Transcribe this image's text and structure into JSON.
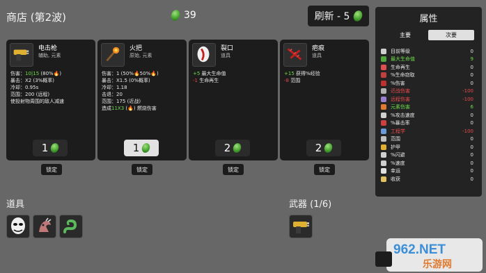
{
  "header": {
    "shop_title": "商店 (第2波)",
    "currency": "39",
    "refresh_label": "刷新 - 5"
  },
  "cards": [
    {
      "name": "电击枪",
      "tags": "辅助, 元素",
      "icon": "taser-icon",
      "stats": [
        {
          "parts": [
            {
              "t": "伤害：",
              "c": ""
            },
            {
              "t": "10|15",
              "c": "pos"
            },
            {
              "t": " (80%🔥)",
              "c": ""
            }
          ]
        },
        {
          "parts": [
            {
              "t": "暴击：X2 (3%概率)",
              "c": ""
            }
          ]
        },
        {
          "parts": [
            {
              "t": "冷却：0.95s",
              "c": ""
            }
          ]
        },
        {
          "parts": [
            {
              "t": "范围：200 (远程)",
              "c": ""
            }
          ]
        },
        {
          "parts": [
            {
              "t": "使投射物周围的敌人减速",
              "c": ""
            }
          ]
        }
      ],
      "price": "1",
      "price_style": "dark",
      "lock_label": "锁定"
    },
    {
      "name": "火把",
      "tags": "原始, 元素",
      "icon": "torch-icon",
      "stats": [
        {
          "parts": [
            {
              "t": "伤害：1 (50%🔥50%🔥)",
              "c": ""
            }
          ]
        },
        {
          "parts": [
            {
              "t": "暴击：X1.5 (0%概率)",
              "c": ""
            }
          ]
        },
        {
          "parts": [
            {
              "t": "冷却：1.18",
              "c": ""
            }
          ]
        },
        {
          "parts": [
            {
              "t": "击退：20",
              "c": ""
            }
          ]
        },
        {
          "parts": [
            {
              "t": "范围：175 (近战)",
              "c": ""
            }
          ]
        },
        {
          "parts": [
            {
              "t": "造成",
              "c": ""
            },
            {
              "t": "11X3",
              "c": "pos"
            },
            {
              "t": " (🔥) 燃烧伤害",
              "c": ""
            }
          ]
        }
      ],
      "price": "1",
      "price_style": "light",
      "lock_label": "锁定"
    },
    {
      "name": "裂口",
      "tags": "道具",
      "icon": "rift-icon",
      "stats": [
        {
          "parts": [
            {
              "t": "+5",
              "c": "pos"
            },
            {
              "t": " 最大生命值",
              "c": ""
            }
          ]
        },
        {
          "parts": [
            {
              "t": "-1",
              "c": "neg"
            },
            {
              "t": " 生命再生",
              "c": ""
            }
          ]
        }
      ],
      "price": "2",
      "price_style": "dark",
      "lock_label": "锁定"
    },
    {
      "name": "疤痕",
      "tags": "道具",
      "icon": "scar-icon",
      "stats": [
        {
          "parts": [
            {
              "t": "+15",
              "c": "pos"
            },
            {
              "t": " 获得%经验",
              "c": ""
            }
          ]
        },
        {
          "parts": [
            {
              "t": "-8",
              "c": "neg"
            },
            {
              "t": " 范围",
              "c": ""
            }
          ]
        }
      ],
      "price": "2",
      "price_style": "dark",
      "lock_label": "锁定"
    }
  ],
  "items_section": {
    "title": "道具",
    "slots": [
      "mask-icon",
      "claw-creature-icon",
      "snake-icon"
    ]
  },
  "weapons_section": {
    "title": "武器 (1/6)",
    "slots": [
      "taser-icon"
    ]
  },
  "attributes": {
    "title": "属性",
    "tab_primary": "主要",
    "tab_secondary": "次要",
    "rows": [
      {
        "label": "目前等级",
        "value": "0",
        "color": "white",
        "icon": "level-icon",
        "icolor": "#cfcfcf"
      },
      {
        "label": "最大生命值",
        "value": "9",
        "color": "green",
        "icon": "heart-icon",
        "icolor": "#4fa83a"
      },
      {
        "label": "生命再生",
        "value": "0",
        "color": "white",
        "icon": "regen-icon",
        "icolor": "#e05050"
      },
      {
        "label": "%生命窃取",
        "value": "0",
        "color": "white",
        "icon": "lifesteal-icon",
        "icolor": "#c04040"
      },
      {
        "label": "%伤害",
        "value": "0",
        "color": "white",
        "icon": "damage-icon",
        "icolor": "#c03030"
      },
      {
        "label": "近战伤害",
        "value": "-100",
        "color": "red",
        "icon": "melee-icon",
        "icolor": "#b0b0b0"
      },
      {
        "label": "远程伤害",
        "value": "-100",
        "color": "red",
        "icon": "ranged-icon",
        "icolor": "#9a7fd0"
      },
      {
        "label": "元素伤害",
        "value": "6",
        "color": "green",
        "icon": "elemental-icon",
        "icolor": "#e07a30"
      },
      {
        "label": "%攻击速度",
        "value": "0",
        "color": "white",
        "icon": "attack-speed-icon",
        "icolor": "#d0d0d0"
      },
      {
        "label": "%暴击率",
        "value": "0",
        "color": "white",
        "icon": "crit-icon",
        "icolor": "#d04040"
      },
      {
        "label": "工程学",
        "value": "-100",
        "color": "red",
        "icon": "engineering-icon",
        "icolor": "#6a9ad8"
      },
      {
        "label": "范围",
        "value": "0",
        "color": "white",
        "icon": "range-icon",
        "icolor": "#c0c0c0"
      },
      {
        "label": "护甲",
        "value": "0",
        "color": "white",
        "icon": "armor-icon",
        "icolor": "#e0b030"
      },
      {
        "label": "%闪避",
        "value": "0",
        "color": "white",
        "icon": "dodge-icon",
        "icolor": "#d0d0d0"
      },
      {
        "label": "%速度",
        "value": "0",
        "color": "white",
        "icon": "speed-icon",
        "icolor": "#d0d0d0"
      },
      {
        "label": "幸运",
        "value": "0",
        "color": "white",
        "icon": "luck-icon",
        "icolor": "#e0e0e0"
      },
      {
        "label": "收获",
        "value": "0",
        "color": "white",
        "icon": "harvest-icon",
        "icolor": "#e0c060"
      }
    ]
  },
  "watermark": {
    "line1": "962.NET",
    "line2": "乐游网"
  }
}
